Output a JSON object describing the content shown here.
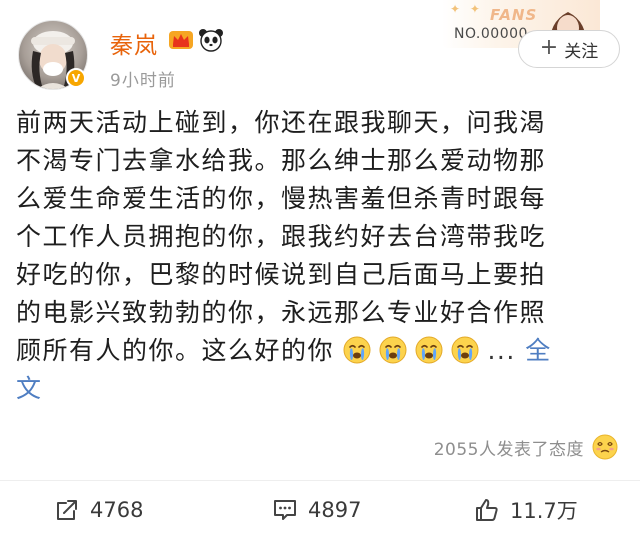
{
  "post": {
    "author": {
      "name": "秦岚",
      "badges": [
        "crown-icon",
        "panda-icon"
      ],
      "verified": true
    },
    "timestamp": "9小时前",
    "fans_card": {
      "label": "FANS",
      "number": "NO.00000"
    },
    "follow_button": {
      "plus": "+",
      "label": "关注"
    },
    "text_lines": [
      "前两天活动上碰到，你还在跟我聊天，问我渴",
      "不渴专门去拿水给我。那么绅士那么爱动物那",
      "么爱生命爱生活的你，慢热害羞但杀青时跟每",
      "个工作人员拥抱的你，跟我约好去台湾带我吃",
      "好吃的你，巴黎的时候说到自己后面马上要拍",
      "的电影兴致勃勃的你，永远那么专业好合作照",
      "顾所有人的你。这么好的你"
    ],
    "emoji_count": 4,
    "emoji_icon": "crying-face-icon",
    "ellipsis": "...",
    "expand_link": "全文",
    "reactions": {
      "text": "2055人发表了态度",
      "icon": "dizzy-face-icon"
    },
    "actions": {
      "repost": {
        "icon": "repost-icon",
        "count": "4768"
      },
      "comment": {
        "icon": "comment-icon",
        "count": "4897"
      },
      "like": {
        "icon": "thumbs-up-icon",
        "count": "11.7万"
      }
    }
  },
  "colors": {
    "username": "#e8630a",
    "link": "#4f7ec2",
    "meta": "#9a9a9a"
  }
}
